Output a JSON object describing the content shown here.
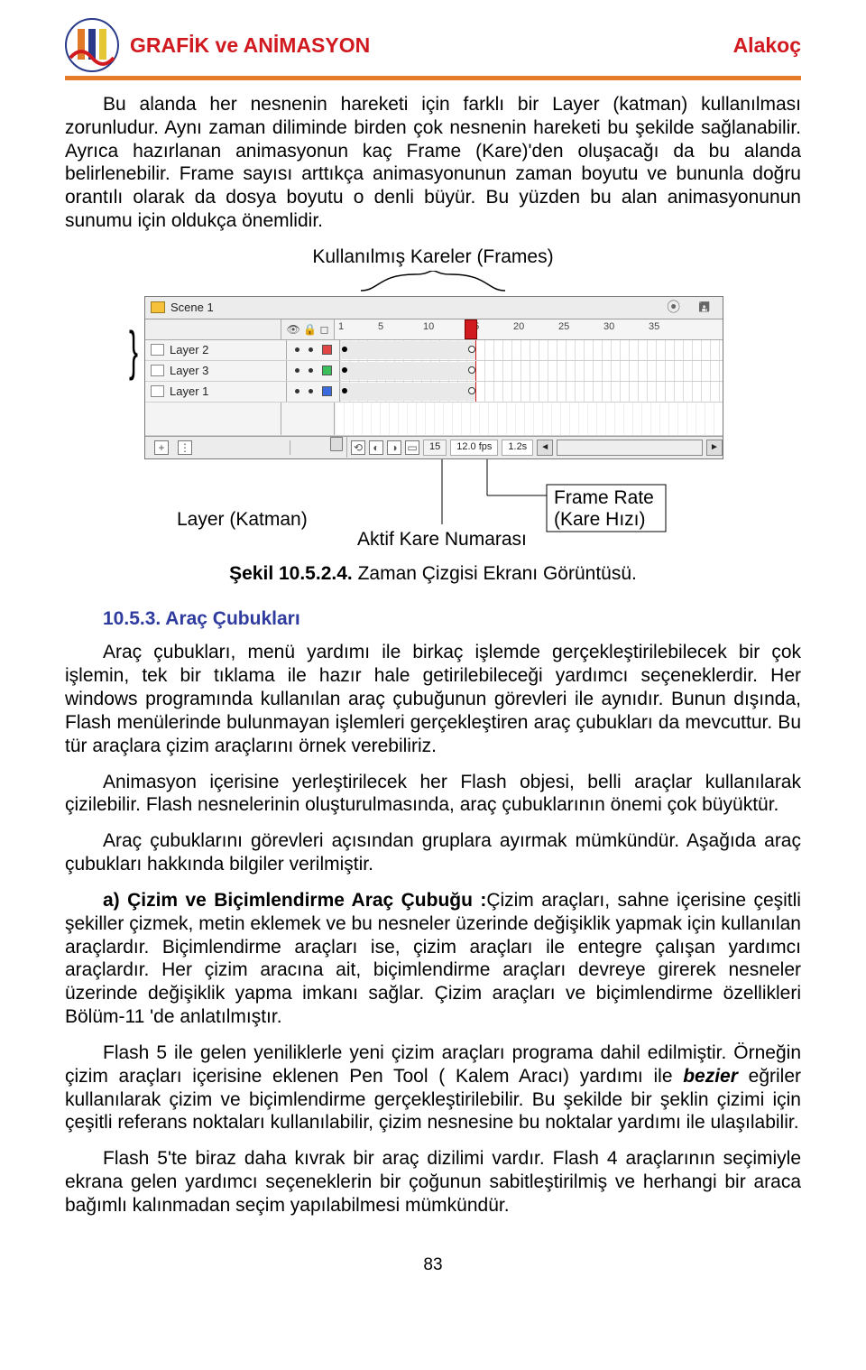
{
  "header": {
    "title_left": "GRAFİK ve ANİMASYON",
    "title_right": "Alakoç"
  },
  "paragraphs": {
    "p1": "Bu alanda her nesnenin hareketi için farklı bir Layer (katman) kullanılması zorunludur. Aynı zaman diliminde birden çok nesnenin hareketi bu şekilde sağlanabilir. Ayrıca hazırlanan animasyonun kaç Frame (Kare)'den oluşacağı da bu alanda belirlenebilir. Frame sayısı arttıkça animasyonunun zaman boyutu ve bununla doğru orantılı olarak da dosya boyutu o denli büyür. Bu yüzden bu alan animasyonunun sunumu için oldukça önemlidir.",
    "p3": "Araç çubukları, menü yardımı ile birkaç işlemde gerçekleştirilebilecek bir çok işlemin, tek bir tıklama ile hazır hale getirilebileceği yardımcı seçeneklerdir. Her windows programında kullanılan araç çubuğunun görevleri ile aynıdır. Bunun dışında, Flash menülerinde bulunmayan işlemleri gerçekleştiren araç çubukları da mevcuttur. Bu tür araçlara çizim araçlarını örnek verebiliriz.",
    "p4": "Animasyon içerisine yerleştirilecek her Flash objesi, belli araçlar kullanılarak çizilebilir. Flash nesnelerinin oluşturulmasında, araç çubuklarının önemi çok büyüktür.",
    "p5": "Araç çubuklarını görevleri açısından gruplara ayırmak mümkündür. Aşağıda araç çubukları hakkında bilgiler verilmiştir.",
    "p6_lead": "a) Çizim ve Biçimlendirme Araç Çubuğu :",
    "p6_rest": "Çizim  araçları, sahne içerisine çeşitli şekiller çizmek, metin eklemek ve bu nesneler üzerinde değişiklik yapmak için kullanılan araçlardır. Biçimlendirme araçları ise, çizim araçları ile entegre çalışan yardımcı araçlardır. Her çizim aracına ait, biçimlendirme araçları devreye girerek nesneler üzerinde değişiklik yapma imkanı sağlar. Çizim araçları ve biçimlendirme özellikleri  Bölüm-11 'de anlatılmıştır.",
    "p7a": "Flash 5 ile gelen yeniliklerle yeni çizim araçları programa dahil edilmiştir. Örneğin çizim araçları içerisine eklenen Pen Tool ( Kalem Aracı) yardımı ile ",
    "p7_bez": "bezier",
    "p7b": " eğriler kullanılarak çizim ve biçimlendirme gerçekleştirilebilir. Bu şekilde bir şeklin çizimi için çeşitli  referans noktaları  kullanılabilir, çizim nesnesine bu noktalar yardımı ile ulaşılabilir.",
    "p8": "Flash 5'te biraz daha kıvrak bir araç dizilimi vardır. Flash 4 araçlarının seçimiyle ekrana gelen yardımcı seçeneklerin bir çoğunun sabitleştirilmiş ve herhangi bir araca bağımlı kalınmadan seçim yapılabilmesi mümkündür."
  },
  "figure": {
    "top_label": "Kullanılmış Kareler  (Frames)",
    "annot_layer": "Layer (Katman)",
    "annot_aktif": "Aktif Kare Numarası",
    "annot_rate1": "Frame Rate",
    "annot_rate2": "(Kare Hızı)",
    "caption_bold": "Şekil 10.5.2.4.",
    "caption_rest": " Zaman Çizgisi Ekranı Görüntüsü."
  },
  "section": {
    "h": "10.5.3.  Araç Çubukları"
  },
  "timeline": {
    "scene": "Scene 1",
    "ticks": [
      "1",
      "5",
      "10",
      "15",
      "20",
      "25",
      "30",
      "35"
    ],
    "layers": [
      {
        "name": "Layer 2",
        "color": "r"
      },
      {
        "name": "Layer 3",
        "color": "g"
      },
      {
        "name": "Layer 1",
        "color": "b"
      }
    ],
    "status": {
      "frame": "15",
      "fps": "12.0 fps",
      "time": "1.2s"
    }
  },
  "page_number": "83"
}
